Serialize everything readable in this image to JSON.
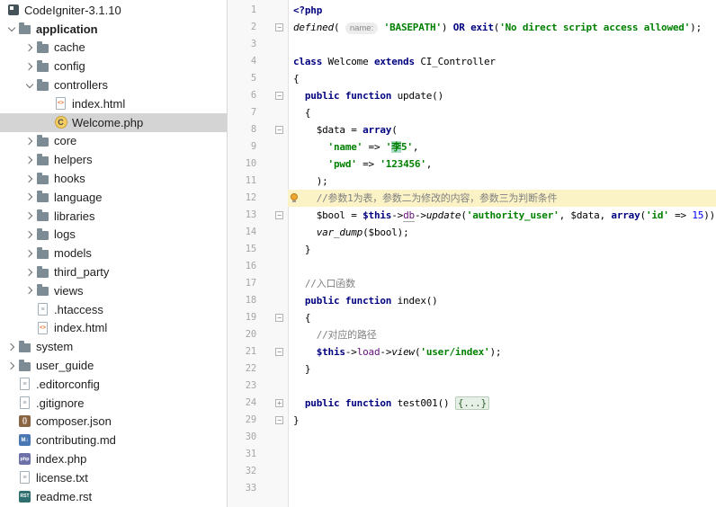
{
  "colors": {
    "keyword": "#000080",
    "string": "#008000",
    "number": "#0000ff",
    "comment": "#808080",
    "property": "#660e7a",
    "caret_line_bg": "#fbf3c6",
    "tree_selection_bg": "#d4d4d4",
    "gutter_text": "#a6a6a6",
    "folded_text_bg": "#e6f0e6",
    "class_icon_bg": "#f3cc62",
    "bulb": "#efa732"
  },
  "project_tree": {
    "root_label": "CodeIgniter-3.1.10",
    "items": [
      {
        "label": "application",
        "level": 1,
        "icon": "folder",
        "chevron": "expanded",
        "bold": true
      },
      {
        "label": "cache",
        "level": 2,
        "icon": "folder",
        "chevron": "collapsed"
      },
      {
        "label": "config",
        "level": 2,
        "icon": "folder",
        "chevron": "collapsed"
      },
      {
        "label": "controllers",
        "level": 2,
        "icon": "folder",
        "chevron": "expanded"
      },
      {
        "label": "index.html",
        "level": 3,
        "icon": "html"
      },
      {
        "label": "Welcome.php",
        "level": 3,
        "icon": "php-class",
        "selected": true
      },
      {
        "label": "core",
        "level": 2,
        "icon": "folder",
        "chevron": "collapsed"
      },
      {
        "label": "helpers",
        "level": 2,
        "icon": "folder",
        "chevron": "collapsed"
      },
      {
        "label": "hooks",
        "level": 2,
        "icon": "folder",
        "chevron": "collapsed"
      },
      {
        "label": "language",
        "level": 2,
        "icon": "folder",
        "chevron": "collapsed"
      },
      {
        "label": "libraries",
        "level": 2,
        "icon": "folder",
        "chevron": "collapsed"
      },
      {
        "label": "logs",
        "level": 2,
        "icon": "folder",
        "chevron": "collapsed"
      },
      {
        "label": "models",
        "level": 2,
        "icon": "folder",
        "chevron": "collapsed"
      },
      {
        "label": "third_party",
        "level": 2,
        "icon": "folder",
        "chevron": "collapsed"
      },
      {
        "label": "views",
        "level": 2,
        "icon": "folder",
        "chevron": "collapsed"
      },
      {
        "label": ".htaccess",
        "level": 2,
        "icon": "htaccess"
      },
      {
        "label": "index.html",
        "level": 2,
        "icon": "html"
      },
      {
        "label": "system",
        "level": 1,
        "icon": "folder",
        "chevron": "collapsed"
      },
      {
        "label": "user_guide",
        "level": 1,
        "icon": "folder",
        "chevron": "collapsed"
      },
      {
        "label": ".editorconfig",
        "level": 1,
        "icon": "config"
      },
      {
        "label": ".gitignore",
        "level": 1,
        "icon": "gitignore"
      },
      {
        "label": "composer.json",
        "level": 1,
        "icon": "json"
      },
      {
        "label": "contributing.md",
        "level": 1,
        "icon": "markdown"
      },
      {
        "label": "index.php",
        "level": 1,
        "icon": "php"
      },
      {
        "label": "license.txt",
        "level": 1,
        "icon": "text"
      },
      {
        "label": "readme.rst",
        "level": 1,
        "icon": "rst"
      }
    ]
  },
  "editor": {
    "file": "Welcome.php",
    "lines": [
      {
        "n": 1,
        "segs": [
          {
            "t": "<?php",
            "c": "kw"
          }
        ]
      },
      {
        "n": 2,
        "fold": "open",
        "segs": [
          {
            "t": "defined",
            "c": "fn"
          },
          {
            "t": "( "
          },
          {
            "t": "name:",
            "c": "inlay"
          },
          {
            "t": " "
          },
          {
            "t": "'BASEPATH'",
            "c": "str"
          },
          {
            "t": ") "
          },
          {
            "t": "OR",
            "c": "kw"
          },
          {
            "t": " "
          },
          {
            "t": "exit",
            "c": "kw"
          },
          {
            "t": "("
          },
          {
            "t": "'No direct script access allowed'",
            "c": "str"
          },
          {
            "t": ");"
          }
        ]
      },
      {
        "n": 3,
        "segs": []
      },
      {
        "n": 4,
        "segs": [
          {
            "t": "class",
            "c": "kw"
          },
          {
            "t": " Welcome "
          },
          {
            "t": "extends",
            "c": "kw"
          },
          {
            "t": " CI_Controller"
          }
        ]
      },
      {
        "n": 5,
        "segs": [
          {
            "t": "{"
          }
        ]
      },
      {
        "n": 6,
        "fold": "open",
        "segs": [
          {
            "t": "  "
          },
          {
            "t": "public function",
            "c": "kw"
          },
          {
            "t": " update()"
          }
        ]
      },
      {
        "n": 7,
        "segs": [
          {
            "t": "  {"
          }
        ]
      },
      {
        "n": 8,
        "fold": "open",
        "segs": [
          {
            "t": "    "
          },
          {
            "t": "$data",
            "c": "var"
          },
          {
            "t": " = "
          },
          {
            "t": "array",
            "c": "kw"
          },
          {
            "t": "("
          }
        ]
      },
      {
        "n": 9,
        "segs": [
          {
            "t": "      "
          },
          {
            "t": "'name'",
            "c": "str"
          },
          {
            "t": " => "
          },
          {
            "t": "'",
            "c": "str"
          },
          {
            "t": "李",
            "c": "str hl"
          },
          {
            "t": "5'",
            "c": "str"
          },
          {
            "t": ","
          }
        ]
      },
      {
        "n": 10,
        "segs": [
          {
            "t": "      "
          },
          {
            "t": "'pwd'",
            "c": "str"
          },
          {
            "t": " => "
          },
          {
            "t": "'123456'",
            "c": "str"
          },
          {
            "t": ","
          }
        ]
      },
      {
        "n": 11,
        "segs": [
          {
            "t": "    );"
          }
        ]
      },
      {
        "n": 12,
        "caret": true,
        "bulb": true,
        "segs": [
          {
            "t": "    "
          },
          {
            "t": "//参数1为表，参数二为修改的内容，参数三为判断条件",
            "c": "cmt"
          }
        ]
      },
      {
        "n": 13,
        "fold": "open",
        "segs": [
          {
            "t": "    "
          },
          {
            "t": "$bool",
            "c": "var"
          },
          {
            "t": " = "
          },
          {
            "t": "$this",
            "c": "kw"
          },
          {
            "t": "->"
          },
          {
            "t": "db",
            "c": "prop ul"
          },
          {
            "t": "->"
          },
          {
            "t": "update",
            "c": "fn"
          },
          {
            "t": "("
          },
          {
            "t": "'authority_user'",
            "c": "str"
          },
          {
            "t": ", "
          },
          {
            "t": "$data",
            "c": "var"
          },
          {
            "t": ", "
          },
          {
            "t": "array",
            "c": "kw"
          },
          {
            "t": "("
          },
          {
            "t": "'id'",
            "c": "str"
          },
          {
            "t": " => "
          },
          {
            "t": "15",
            "c": "num"
          },
          {
            "t": "));"
          }
        ]
      },
      {
        "n": 14,
        "segs": [
          {
            "t": "    "
          },
          {
            "t": "var_dump",
            "c": "fn"
          },
          {
            "t": "("
          },
          {
            "t": "$bool",
            "c": "var"
          },
          {
            "t": ");"
          }
        ]
      },
      {
        "n": 15,
        "segs": [
          {
            "t": "  }"
          }
        ]
      },
      {
        "n": 16,
        "segs": []
      },
      {
        "n": 17,
        "segs": [
          {
            "t": "  "
          },
          {
            "t": "//入口函数",
            "c": "cmt"
          }
        ]
      },
      {
        "n": 18,
        "segs": [
          {
            "t": "  "
          },
          {
            "t": "public function",
            "c": "kw"
          },
          {
            "t": " index()"
          }
        ]
      },
      {
        "n": 19,
        "fold": "open",
        "segs": [
          {
            "t": "  {"
          }
        ]
      },
      {
        "n": 20,
        "segs": [
          {
            "t": "    "
          },
          {
            "t": "//对应的路径",
            "c": "cmt"
          }
        ]
      },
      {
        "n": 21,
        "fold": "open",
        "segs": [
          {
            "t": "    "
          },
          {
            "t": "$this",
            "c": "kw"
          },
          {
            "t": "->"
          },
          {
            "t": "load",
            "c": "prop"
          },
          {
            "t": "->"
          },
          {
            "t": "view",
            "c": "fn"
          },
          {
            "t": "("
          },
          {
            "t": "'user/index'",
            "c": "str"
          },
          {
            "t": ");"
          }
        ]
      },
      {
        "n": 22,
        "segs": [
          {
            "t": "  }"
          }
        ]
      },
      {
        "n": 23,
        "segs": []
      },
      {
        "n": 24,
        "fold": "collapsed",
        "segs": [
          {
            "t": "  "
          },
          {
            "t": "public function",
            "c": "kw"
          },
          {
            "t": " test001() "
          },
          {
            "t": "{...}",
            "c": "folded"
          }
        ]
      },
      {
        "n": 29,
        "fold": "end",
        "segs": [
          {
            "t": "}"
          }
        ]
      },
      {
        "n": 30,
        "segs": []
      },
      {
        "n": 31,
        "segs": []
      },
      {
        "n": 32,
        "segs": []
      },
      {
        "n": 33,
        "segs": []
      }
    ]
  }
}
